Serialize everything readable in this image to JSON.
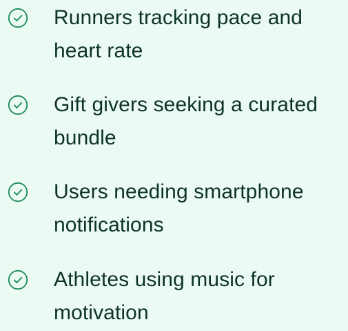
{
  "list": {
    "icon": "check-circle-icon",
    "colors": {
      "background": "#ebfbf3",
      "text": "#0d3325",
      "check": "#1a8a57"
    },
    "items": [
      {
        "text": "Runners tracking pace and heart rate"
      },
      {
        "text": "Gift givers seeking a curated bundle"
      },
      {
        "text": "Users needing smartphone notifications"
      },
      {
        "text": "Athletes using music for motivation"
      }
    ]
  }
}
